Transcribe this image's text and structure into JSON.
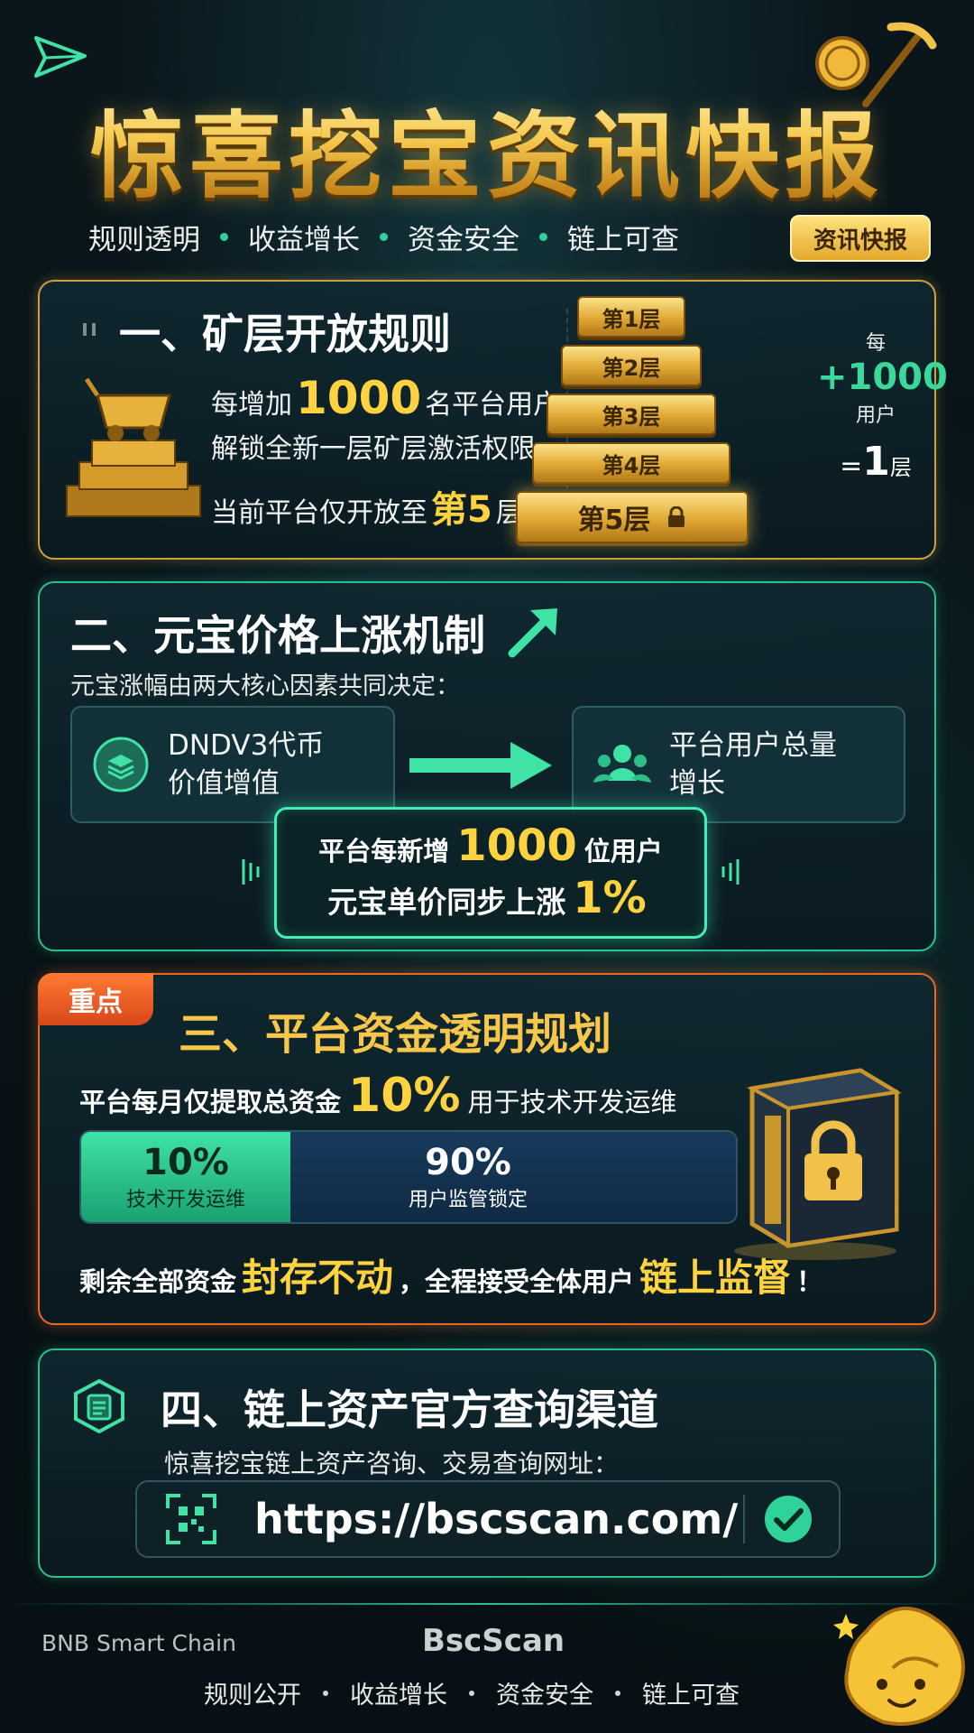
{
  "header": {
    "title": "惊喜挖宝资讯快报",
    "tags": [
      "规则透明",
      "收益增长",
      "资金安全",
      "链上可查"
    ],
    "badge": "资讯快报"
  },
  "section1": {
    "title": "一、矿层开放规则",
    "line1_pre": "每增加",
    "line1_num": "1000",
    "line1_post": "名平台用户，",
    "line2": "解锁全新一层矿层激活权限",
    "line3_pre": "当前平台仅开放至",
    "line3_hl": "第5层",
    "line3_post": "层",
    "line3_hl_short": "第5",
    "layers": [
      "第1层",
      "第2层",
      "第3层",
      "第4层",
      "第5层"
    ],
    "rate_top": "每",
    "rate_plus": "+1000",
    "rate_unit": "用户",
    "rate_eq_sign": "=",
    "rate_eq_num": "1",
    "rate_eq_unit": "层"
  },
  "section2": {
    "title": "二、元宝价格上涨机制",
    "subtitle": "元宝涨幅由两大核心因素共同决定：",
    "factor1": [
      "DNDV3代币",
      "价值增值"
    ],
    "factor2": [
      "平台用户总量",
      "增长"
    ],
    "row1_pre": "平台每新增",
    "row1_num": "1000",
    "row1_post": "位用户",
    "row2_pre": "元宝单价同步上涨",
    "row2_num": "1%"
  },
  "section3": {
    "tag": "重点",
    "title": "三、平台资金透明规划",
    "withdraw_pre": "平台每月仅提取总资金",
    "withdraw_num": "10%",
    "withdraw_post": "用于技术开发运维",
    "alloc": [
      {
        "pct": "10%",
        "label": "技术开发运维",
        "value": 10
      },
      {
        "pct": "90%",
        "label": "用户监管锁定",
        "value": 90
      }
    ],
    "bottom_pre": "剩余全部资金",
    "bottom_hl1": "封存不动",
    "bottom_mid": "，全程接受全体用户",
    "bottom_hl2": "链上监督",
    "bottom_post": "！"
  },
  "section4": {
    "title": "四、链上资产官方查询渠道",
    "subtitle": "惊喜挖宝链上资产咨询、交易查询网址：",
    "url": "https://bscscan.com/"
  },
  "footer": {
    "chain": "BNB Smart Chain",
    "brand": "BscScan",
    "tags": [
      "规则公开",
      "收益增长",
      "资金安全",
      "链上可查"
    ]
  },
  "colors": {
    "gold": "#ffd23f",
    "green": "#2dbf8f",
    "orange": "#e46a2a",
    "background": "#081217"
  }
}
